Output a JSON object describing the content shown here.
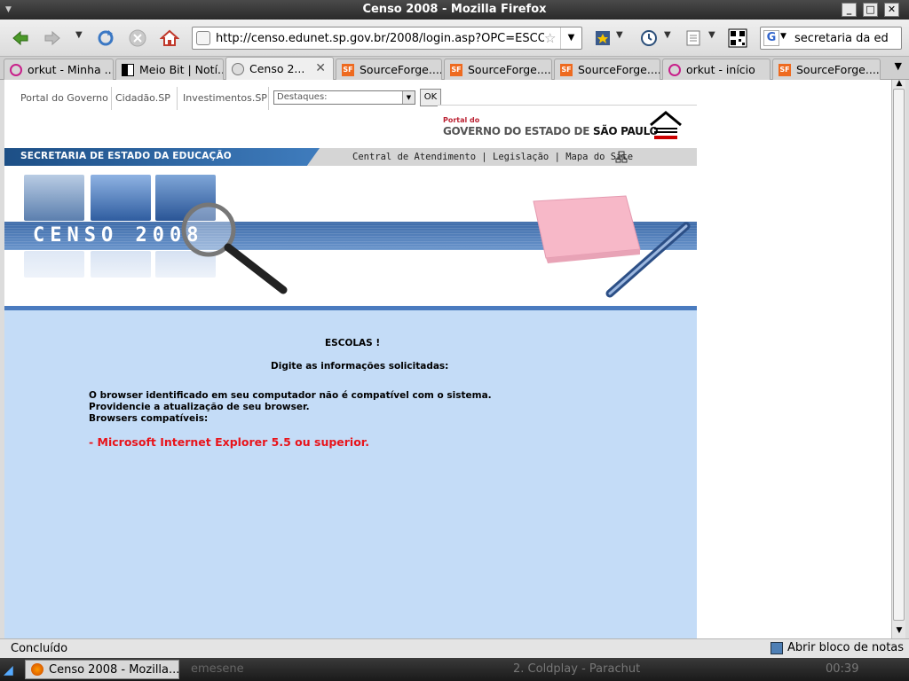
{
  "window": {
    "title": "Censo 2008 - Mozilla Firefox"
  },
  "nav": {
    "url": "http://censo.edunet.sp.gov.br/2008/login.asp?OPC=ESCOLAS",
    "search_value": "secretaria da ed"
  },
  "tabs": [
    {
      "label": "orkut - Minha ...",
      "icon": "orkut-icon"
    },
    {
      "label": "Meio Bit | Notí...",
      "icon": "meiobit-icon"
    },
    {
      "label": "Censo 2...",
      "icon": "page-icon",
      "active": true
    },
    {
      "label": "SourceForge....",
      "icon": "sourceforge-icon"
    },
    {
      "label": "SourceForge....",
      "icon": "sourceforge-icon"
    },
    {
      "label": "SourceForge....",
      "icon": "sourceforge-icon"
    },
    {
      "label": "orkut - início",
      "icon": "orkut-icon"
    },
    {
      "label": "SourceForge....",
      "icon": "sourceforge-icon"
    }
  ],
  "page": {
    "gov_links": [
      "Portal do Governo",
      "Cidadão.SP",
      "Investimentos.SP"
    ],
    "destaques_selected": "Destaques:",
    "ok_label": "OK",
    "portal_small": "Portal do",
    "portal_big_a": "GOVERNO DO ESTADO DE",
    "portal_big_b": "SÃO PAULO",
    "secretaria": "SECRETARIA DE ESTADO DA EDUCAÇÃO",
    "top_links": "Central de Atendimento | Legislação | Mapa do Site",
    "banner_text": "CENSO 2008",
    "heading": "ESCOLAS !",
    "subheading": "Digite as informações solicitadas:",
    "msg1": "O browser identificado em seu computador não é compatível com o sistema.",
    "msg2": "Providencie a atualização de seu browser.",
    "msg3": "Browsers compatíveis:",
    "browser_req": "- Microsoft Internet Explorer 5.5 ou superior."
  },
  "status": {
    "text": "Concluído",
    "notes": "Abrir bloco de notas"
  },
  "taskbar": {
    "task": "Censo 2008 - Mozilla...",
    "task2": "emesene",
    "task3": "2. Coldplay - Parachut",
    "clock": "00:39"
  },
  "colors": {
    "page_bg": "#c4dcf7",
    "warning_red": "#e8141b",
    "header_blue": "#1d4f86"
  }
}
